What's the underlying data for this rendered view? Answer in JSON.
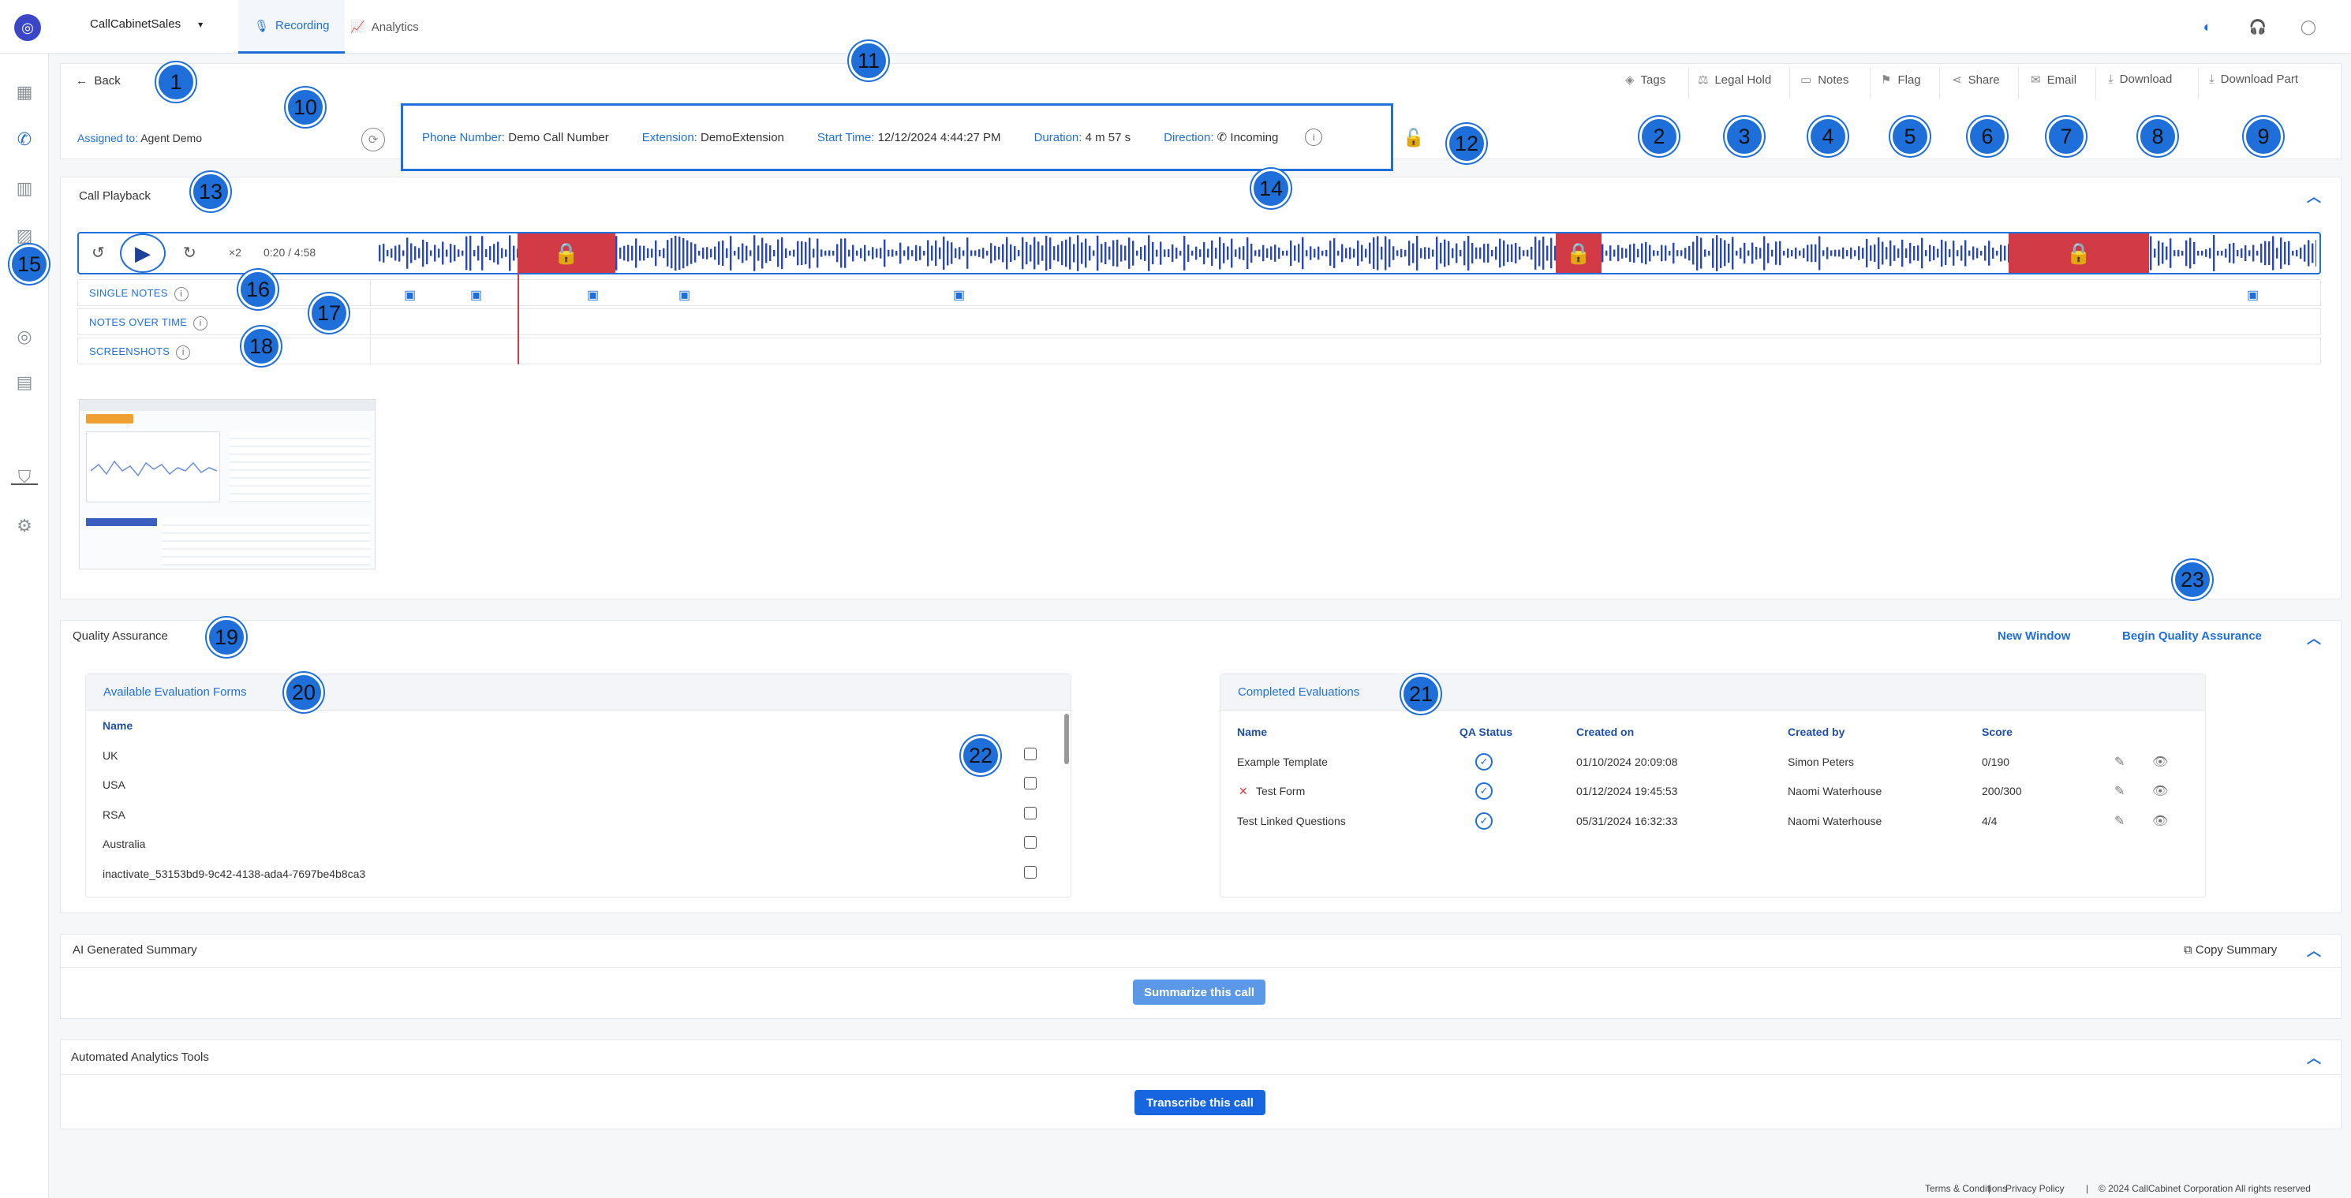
{
  "topbar": {
    "account": "CallCabinetSales",
    "tabs": [
      {
        "label": "Recording",
        "active": true
      },
      {
        "label": "Analytics",
        "active": false
      }
    ]
  },
  "back_label": "Back",
  "actions": [
    "Tags",
    "Legal Hold",
    "Notes",
    "Flag",
    "Share",
    "Email",
    "Download",
    "Download Part"
  ],
  "assigned": {
    "label": "Assigned to:",
    "value": "Agent Demo"
  },
  "info": {
    "phone_label": "Phone Number:",
    "phone": "Demo Call Number",
    "ext_label": "Extension:",
    "ext": "DemoExtension",
    "start_label": "Start Time:",
    "start": "12/12/2024 4:44:27 PM",
    "duration_label": "Duration:",
    "duration": "4 m 57 s",
    "direction_label": "Direction:",
    "direction": "Incoming"
  },
  "playback": {
    "title": "Call Playback",
    "speed": "×2",
    "time": "0:20 / 4:58",
    "rows": [
      "SINGLE NOTES",
      "NOTES OVER TIME",
      "SCREENSHOTS"
    ]
  },
  "qa": {
    "title": "Quality Assurance",
    "new_window": "New Window",
    "begin": "Begin Quality Assurance",
    "available": {
      "title": "Available Evaluation Forms",
      "col": "Name",
      "forms": [
        "UK",
        "USA",
        "RSA",
        "Australia",
        "inactivate_53153bd9-9c42-4138-ada4-7697be4b8ca3"
      ]
    },
    "completed": {
      "title": "Completed Evaluations",
      "cols": [
        "Name",
        "QA Status",
        "Created on",
        "Created by",
        "Score"
      ],
      "rows": [
        {
          "name": "Example Template",
          "created": "01/10/2024 20:09:08",
          "by": "Simon Peters",
          "score": "0/190"
        },
        {
          "name": "Test Form",
          "created": "01/12/2024 19:45:53",
          "by": "Naomi Waterhouse",
          "score": "200/300"
        },
        {
          "name": "Test Linked Questions",
          "created": "05/31/2024 16:32:33",
          "by": "Naomi Waterhouse",
          "score": "4/4"
        }
      ]
    }
  },
  "summary": {
    "title": "AI Generated Summary",
    "copy": "Copy Summary",
    "button": "Summarize this call"
  },
  "analytics": {
    "title": "Automated Analytics Tools",
    "button": "Transcribe this call"
  },
  "footer": {
    "terms": "Terms & Conditions",
    "privacy": "Privacy Policy",
    "copyright": "© 2024 CallCabinet Corporation All rights reserved"
  },
  "callouts": [
    "1",
    "2",
    "3",
    "4",
    "5",
    "6",
    "7",
    "8",
    "9",
    "10",
    "11",
    "12",
    "13",
    "14",
    "15",
    "16",
    "17",
    "18",
    "19",
    "20",
    "21",
    "22",
    "23"
  ],
  "colors": {
    "accent": "#1e6fd9",
    "lock_red": "#d23a45"
  }
}
